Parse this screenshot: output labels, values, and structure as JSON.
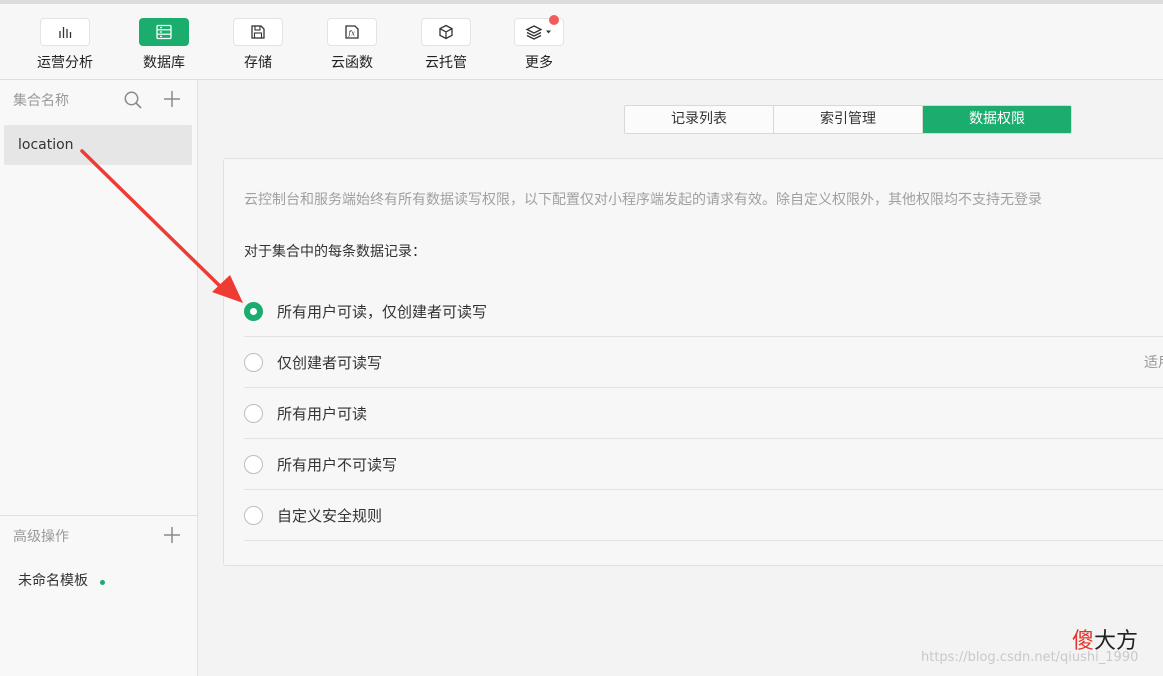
{
  "toolbar": {
    "tools": [
      {
        "label": "运营分析",
        "icon": "bar-chart-icon"
      },
      {
        "label": "数据库",
        "icon": "database-icon"
      },
      {
        "label": "存储",
        "icon": "save-icon"
      },
      {
        "label": "云函数",
        "icon": "function-icon"
      },
      {
        "label": "云托管",
        "icon": "cube-icon"
      },
      {
        "label": "更多",
        "icon": "layers-icon"
      }
    ],
    "active_tool": "数据库",
    "accent_color": "#1aad6e",
    "notify_color": "#f25b5b"
  },
  "sidebar": {
    "collections_title": "集合名称",
    "collections": [
      "location"
    ],
    "advanced_title": "高级操作",
    "templates": [
      "未命名模板"
    ]
  },
  "tabs": {
    "items": [
      "记录列表",
      "索引管理",
      "数据权限"
    ],
    "active": "数据权限"
  },
  "permissions": {
    "description": "云控制台和服务端始终有所有数据读写权限，以下配置仅对小程序端发起的请求有效。除自定义权限外，其他权限均不支持无登录",
    "question": "对于集合中的每条数据记录：",
    "options": [
      {
        "label": "所有用户可读，仅创建者可读写",
        "selected": true,
        "hint": ""
      },
      {
        "label": "仅创建者可读写",
        "selected": false,
        "hint": "适用"
      },
      {
        "label": "所有用户可读",
        "selected": false,
        "hint": ""
      },
      {
        "label": "所有用户不可读写",
        "selected": false,
        "hint": ""
      },
      {
        "label": "自定义安全规则",
        "selected": false,
        "hint": ""
      }
    ]
  },
  "annotation_arrow_color": "#ee3b33",
  "watermark": {
    "brand_red": "傻",
    "brand_dark": "大方",
    "url": "https://blog.csdn.net/qiushi_1990"
  }
}
